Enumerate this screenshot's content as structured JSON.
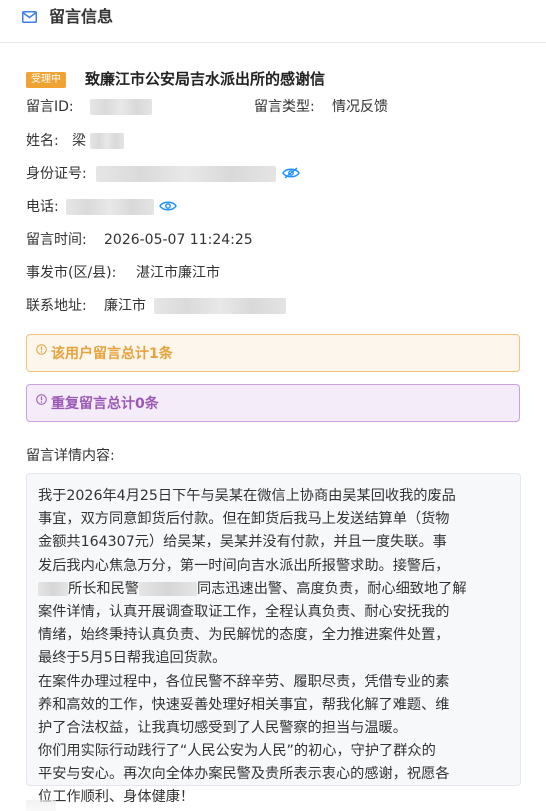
{
  "header": {
    "title": "留言信息",
    "icon": "mail-icon"
  },
  "message": {
    "status_badge": "受理中",
    "title": "致廉江市公安局吉水派出所的感谢信",
    "colors": {
      "badge": "#f0a232",
      "link_icon": "#1e90ff"
    }
  },
  "fields": {
    "id_label": "留言ID:",
    "type_label": "留言类型:",
    "type_value": "情况反馈",
    "name_label": "姓名:",
    "name_value": "梁",
    "idcard_label": "身份证号:",
    "phone_label": "电话:",
    "time_label": "留言时间:",
    "time_value": "2026-05-07 11:24:25",
    "city_label": "事发市(区/县):",
    "city_value": "湛江市廉江市",
    "address_label": "联系地址:",
    "address_value": "廉江市"
  },
  "alerts": {
    "user_total": "该用户留言总计1条",
    "duplicate_total": "重复留言总计0条"
  },
  "detail": {
    "label": "留言详情内容:",
    "lines": [
      "我于2026年4月25日下午与吴某在微信上协商由吴某回收我的废品",
      "事宜，双方同意卸货后付款。但在卸货后我马上发送结算单（货物",
      "金额共164307元）给吴某，吴某并没有付款，并且一度失联。事",
      "发后我内心焦急万分，第一时间向吉水派出所报警求助。接警后，",
      "",
      "案件详情，认真开展调查取证工作，全程认真负责、耐心安抚我的",
      "情绪，始终秉持认真负责、为民解忧的态度，全力推进案件处置，",
      "最终于5月5日帮我追回货款。",
      "在案件办理过程中，各位民警不辞辛劳、履职尽责，凭借专业的素",
      "养和高效的工作，快速妥善处理好相关事宜，帮我化解了难题、维",
      "护了合法权益，让我真切感受到了人民警察的担当与温暖。",
      "你们用实际行动践行了“人民公安为人民”的初心，守护了群众的",
      "平安与安心。再次向全体办案民警及贵所表示衷心的感谢，祝愿各",
      "位工作顺利、身体健康！"
    ],
    "line5_parts": {
      "a": "所长和民警",
      "b": "同志迅速出警、高度负责，耐心细致地了解"
    }
  }
}
